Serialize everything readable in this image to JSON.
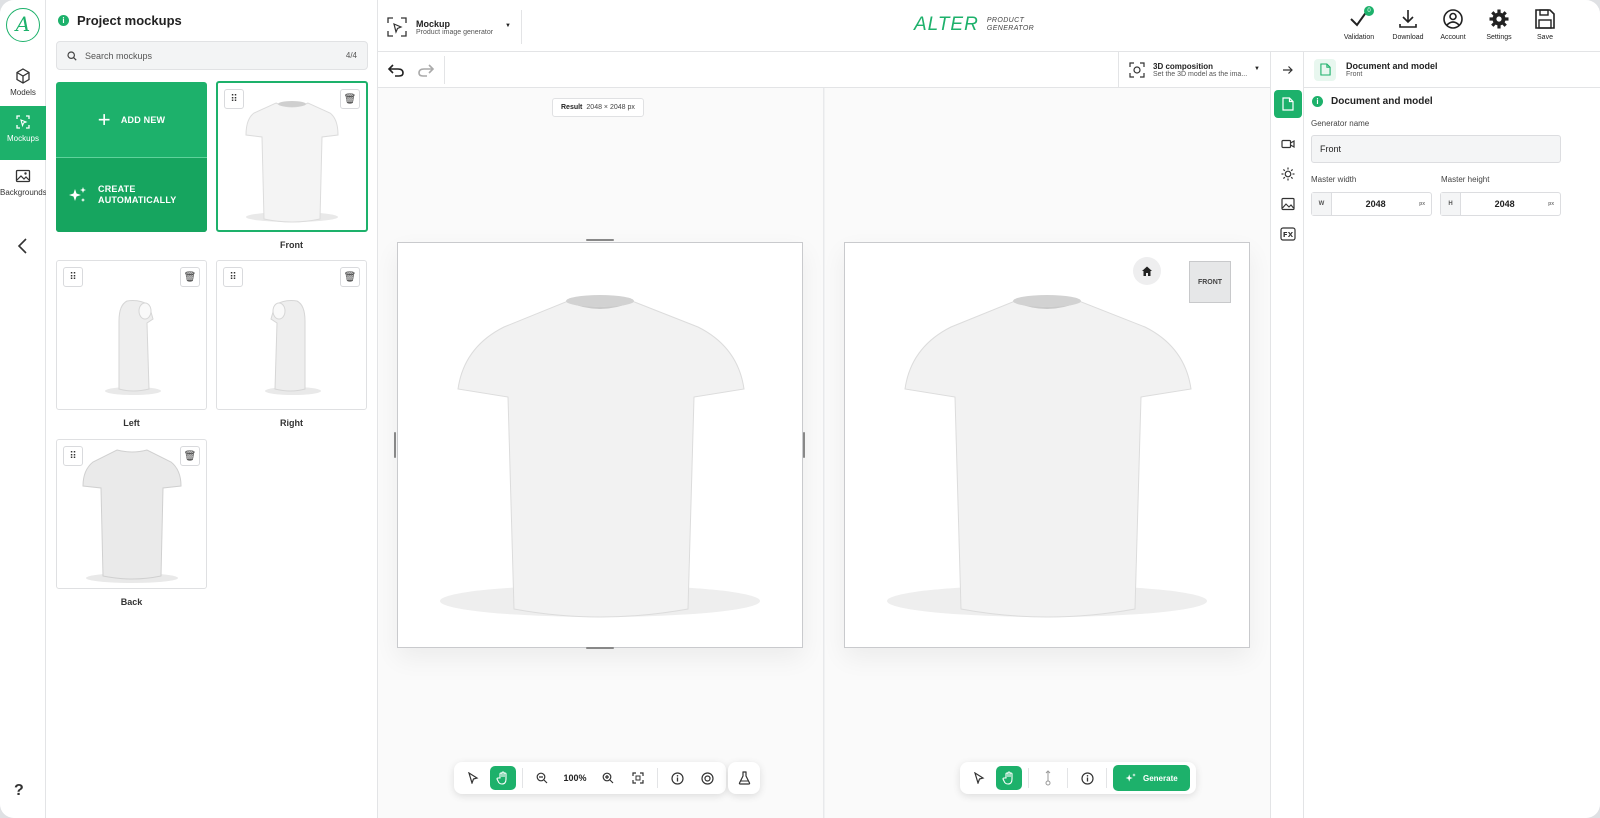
{
  "app": {
    "logo_letter": "A",
    "brand_name": "ALTER",
    "brand_sub_line1": "PRODUCT",
    "brand_sub_line2": "GENERATOR"
  },
  "rail": {
    "items": [
      {
        "label": "Models",
        "icon": "cube-icon"
      },
      {
        "label": "Mockups",
        "icon": "mockup-icon",
        "active": true
      },
      {
        "label": "Backgrounds",
        "icon": "image-icon"
      }
    ],
    "help": "?"
  },
  "panel": {
    "title": "Project mockups",
    "search_placeholder": "Search mockups",
    "count": "4/4",
    "add_new": "ADD NEW",
    "create_line1": "CREATE",
    "create_line2": "AUTOMATICALLY",
    "mockups": [
      {
        "label": "Front",
        "view": "front",
        "selected": true
      },
      {
        "label": "Left",
        "view": "left"
      },
      {
        "label": "Right",
        "view": "right"
      },
      {
        "label": "Back",
        "view": "back"
      }
    ]
  },
  "topbar": {
    "generator_title": "Mockup",
    "generator_subtitle": "Product image generator",
    "buttons": [
      {
        "label": "Validation",
        "icon": "check-icon",
        "badge": "0"
      },
      {
        "label": "Download",
        "icon": "download-icon"
      },
      {
        "label": "Account",
        "icon": "account-icon"
      },
      {
        "label": "Settings",
        "icon": "gear-icon"
      },
      {
        "label": "Save",
        "icon": "save-icon"
      }
    ]
  },
  "canvas": {
    "composition_title": "3D composition",
    "composition_subtitle": "Set the 3D model as the ima...",
    "result_label": "Result",
    "result_size": "2048 × 2048 px",
    "cube_face": "FRONT",
    "zoom": "100%",
    "generate_label": "Generate"
  },
  "props": {
    "header_title": "Document and model",
    "header_subtitle": "Front",
    "section_title": "Document and model",
    "generator_name_label": "Generator name",
    "generator_name_value": "Front",
    "master_width_label": "Master width",
    "master_height_label": "Master height",
    "width_prefix": "W",
    "height_prefix": "H",
    "width_value": "2048",
    "height_value": "2048",
    "unit": "px"
  },
  "colors": {
    "accent": "#1db16b"
  }
}
